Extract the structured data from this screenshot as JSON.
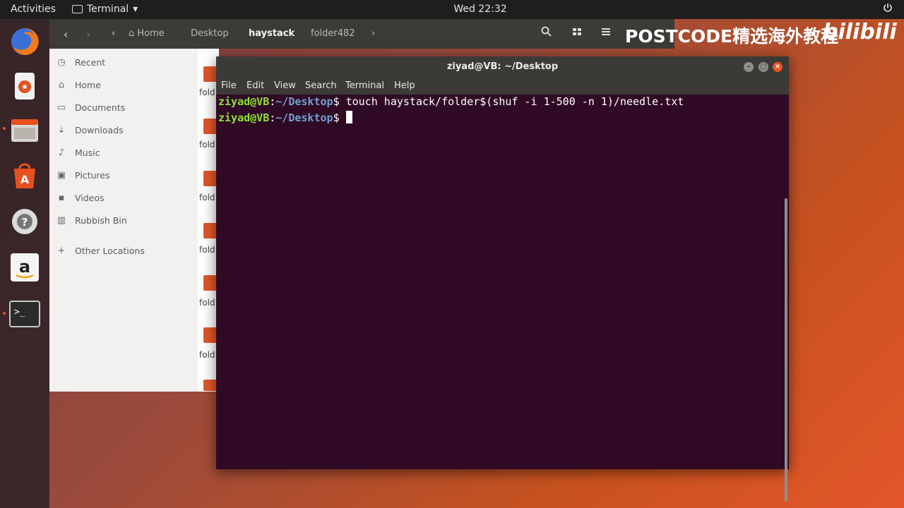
{
  "top_panel": {
    "activities": "Activities",
    "app_name": "Terminal",
    "app_menu_arrow": "▾",
    "clock": "Wed 22:32",
    "power_icon": "power-icon"
  },
  "dock": {
    "items": [
      "firefox-icon",
      "rhythmbox-icon",
      "files-icon",
      "software-icon",
      "help-icon",
      "amazon-icon",
      "terminal-icon"
    ]
  },
  "nautilus": {
    "breadcrumbs": [
      "Home",
      "Desktop",
      "haystack",
      "folder482"
    ],
    "sidebar": [
      "Recent",
      "Home",
      "Documents",
      "Downloads",
      "Music",
      "Pictures",
      "Videos",
      "Rubbish Bin",
      "Other Locations"
    ],
    "folder_label": "fold"
  },
  "watermark": {
    "text": "POSTCODE精选海外教程",
    "bilibili": "bilibili"
  },
  "terminal": {
    "title": "ziyad@VB: ~/Desktop",
    "menu": [
      "File",
      "Edit",
      "View",
      "Search",
      "Terminal",
      "Help"
    ],
    "lines": [
      {
        "user": "ziyad@VB",
        "path": "~/Desktop",
        "symbol": "$",
        "command": " touch haystack/folder$(shuf -i 1-500 -n 1)/needle.txt"
      },
      {
        "user": "ziyad@VB",
        "path": "~/Desktop",
        "symbol": "$",
        "command": " "
      }
    ]
  },
  "colors": {
    "terminal_bg": "#300a24",
    "prompt_user": "#8ae234",
    "prompt_path": "#729fcf",
    "accent": "#e95420"
  }
}
